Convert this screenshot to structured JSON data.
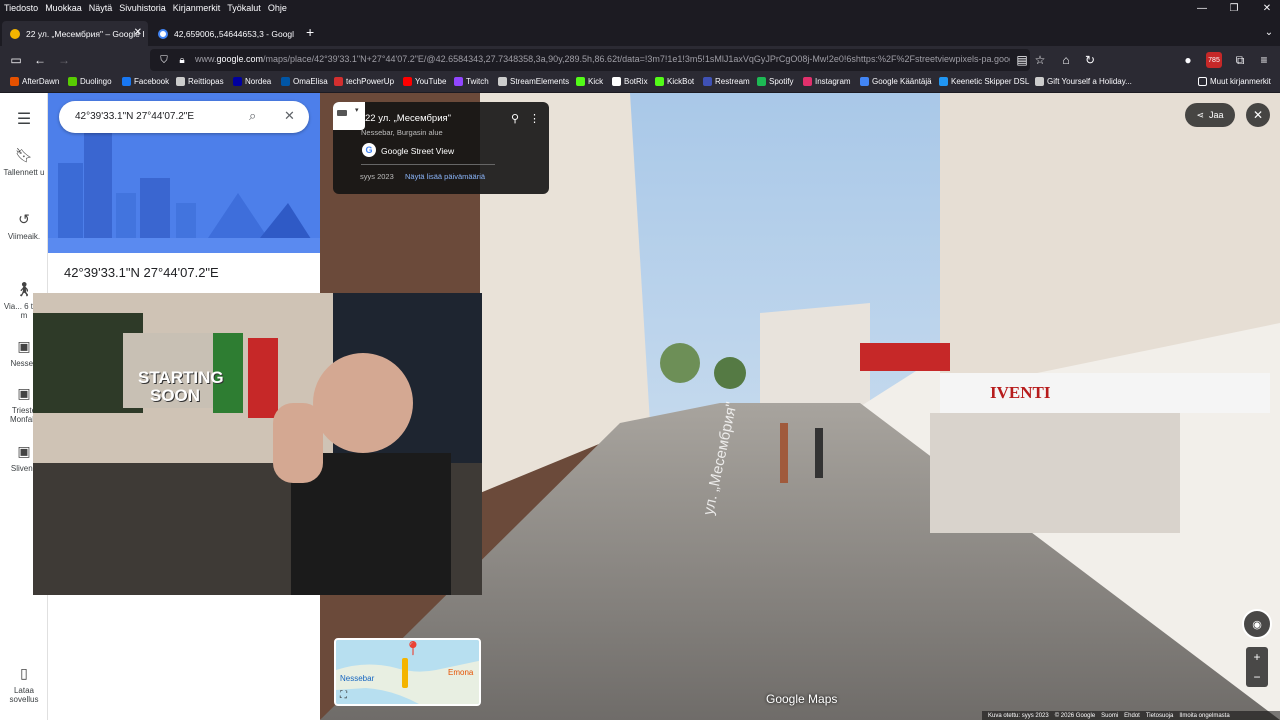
{
  "menu": [
    "Tiedosto",
    "Muokkaa",
    "Näytä",
    "Sivuhistoria",
    "Kirjanmerkit",
    "Työkalut",
    "Ohje"
  ],
  "tabs": [
    {
      "label": "22 ул. „Месембрия\" – Google I"
    },
    {
      "label": "42,659006,,54644653,3 - Googl"
    }
  ],
  "address": {
    "prefix": "www.",
    "domain": "google.com",
    "rest": "/maps/place/42°39'33.1\"N+27°44'07.2\"E/@42.6584343,27.7348358,3a,90y,289.5h,86.62t/data=!3m7!1e1!3m5!1sMlJ1axVqGyJPrCgO08j-Mw!2e0!6shttps:%2F%2Fstreetviewpixels-pa.goog"
  },
  "badge_count": "785",
  "bookmarks": [
    {
      "label": "AfterDawn",
      "color": "#e65100"
    },
    {
      "label": "Duolingo",
      "color": "#58cc02"
    },
    {
      "label": "Facebook",
      "color": "#1877f2"
    },
    {
      "label": "Reittiopas",
      "color": "#cccccc"
    },
    {
      "label": "Nordea",
      "color": "#0000a0"
    },
    {
      "label": "OmaElisa",
      "color": "#0055a5"
    },
    {
      "label": "techPowerUp",
      "color": "#d32f2f"
    },
    {
      "label": "YouTube",
      "color": "#ff0000"
    },
    {
      "label": "Twitch",
      "color": "#9146ff"
    },
    {
      "label": "StreamElements",
      "color": "#cccccc"
    },
    {
      "label": "Kick",
      "color": "#53fc18"
    },
    {
      "label": "BotRix",
      "color": "#ffffff"
    },
    {
      "label": "KickBot",
      "color": "#53fc18"
    },
    {
      "label": "Restream",
      "color": "#3f51b5"
    },
    {
      "label": "Spotify",
      "color": "#1db954"
    },
    {
      "label": "Instagram",
      "color": "#e1306c"
    },
    {
      "label": "Google Kääntäjä",
      "color": "#4285f4"
    },
    {
      "label": "Keenetic Skipper DSL",
      "color": "#2196f3"
    },
    {
      "label": "Gift Yourself a Holiday...",
      "color": "#cccccc"
    }
  ],
  "other_bookmarks": "Muut kirjanmerkit",
  "rail": [
    {
      "label": "Tallennett u"
    },
    {
      "label": "Viimeaik."
    },
    {
      "label": "Via... 6 t 47 m"
    },
    {
      "label": "Nesseb"
    },
    {
      "label": "Trieste Monfalc"
    },
    {
      "label": "Slivene"
    }
  ],
  "rail_bottom": "Lataa sovellus",
  "search": {
    "value": "42°39'33.1\"N 27°44'07.2\"E"
  },
  "place_title": "42°39'33.1\"N 27°44'07.2\"E",
  "streetview_card": {
    "title": "22 ул. „Месембрия\"",
    "subtitle": "Nessebar, Burgasin alue",
    "source": "Google Street View",
    "date": "syys 2023",
    "more_dates": "Näytä lisää päivämääriä"
  },
  "share_label": "Jaa",
  "street_sign": "ул. „Месембрия\"",
  "shop_sign": "IVENTI",
  "webcam_poster": [
    "STARTING",
    "SOON"
  ],
  "minimap": {
    "label1": "Nessebar",
    "label2": "Emona"
  },
  "watermark": "Google Maps",
  "footer": [
    "Kuva otettu: syys 2023",
    "© 2026 Google",
    "Suomi",
    "Ehdot",
    "Tietosuoja",
    "Ilmoita ongelmasta"
  ]
}
